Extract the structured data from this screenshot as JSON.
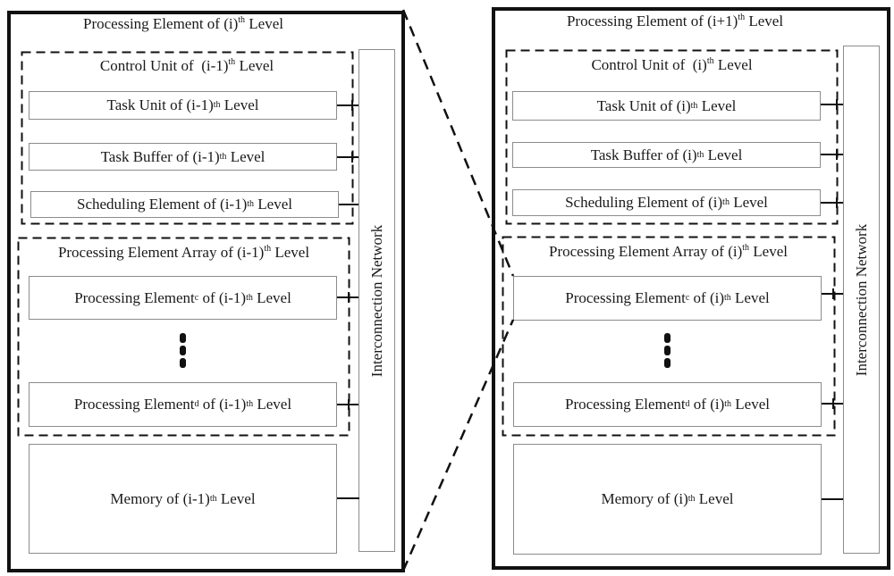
{
  "panels": [
    {
      "title": {
        "prefix": "Processing Element of (i)",
        "sup": "th",
        "suffix": " Level"
      },
      "control_unit": {
        "prefix": "Control Unit of  (i-1)",
        "sup": "th",
        "suffix": " Level"
      },
      "task_unit": {
        "prefix": "Task Unit of (i-1)",
        "sup": "th",
        "suffix": " Level"
      },
      "task_buffer": {
        "prefix": "Task Buffer of (i-1)",
        "sup": "th",
        "suffix": " Level"
      },
      "scheduling": {
        "prefix": "Scheduling Element of (i-1)",
        "sup": "th",
        "suffix": " Level"
      },
      "pe_array": {
        "prefix": "Processing Element Array of (i-1)",
        "sup": "th",
        "suffix": " Level"
      },
      "pe_c": {
        "prefix": "Processing Element",
        "sub": "c",
        "mid": " of (i-1)",
        "sup": "th",
        "suffix": " Level"
      },
      "pe_d": {
        "prefix": "Processing Element",
        "sub": "d",
        "mid": " of (i-1)",
        "sup": "th",
        "suffix": " Level"
      },
      "memory": {
        "prefix": "Memory of (i-1)",
        "sup": "th",
        "suffix": " Level"
      },
      "network": "Interconnection Network"
    },
    {
      "title": {
        "prefix": "Processing Element of (i+1)",
        "sup": "th",
        "suffix": " Level"
      },
      "control_unit": {
        "prefix": "Control Unit of  (i)",
        "sup": "th",
        "suffix": " Level"
      },
      "task_unit": {
        "prefix": "Task Unit of (i)",
        "sup": "th",
        "suffix": " Level"
      },
      "task_buffer": {
        "prefix": "Task Buffer of (i)",
        "sup": "th",
        "suffix": " Level"
      },
      "scheduling": {
        "prefix": "Scheduling Element of (i)",
        "sup": "th",
        "suffix": " Level"
      },
      "pe_array": {
        "prefix": "Processing Element Array of (i)",
        "sup": "th",
        "suffix": " Level"
      },
      "pe_c": {
        "prefix": "Processing Element",
        "sub": "c",
        "mid": " of (i)",
        "sup": "th",
        "suffix": " Level"
      },
      "pe_d": {
        "prefix": "Processing Element",
        "sub": "d",
        "mid": " of (i)",
        "sup": "th",
        "suffix": " Level"
      },
      "memory": {
        "prefix": "Memory of (i)",
        "sup": "th",
        "suffix": " Level"
      },
      "network": "Interconnection Network"
    }
  ]
}
